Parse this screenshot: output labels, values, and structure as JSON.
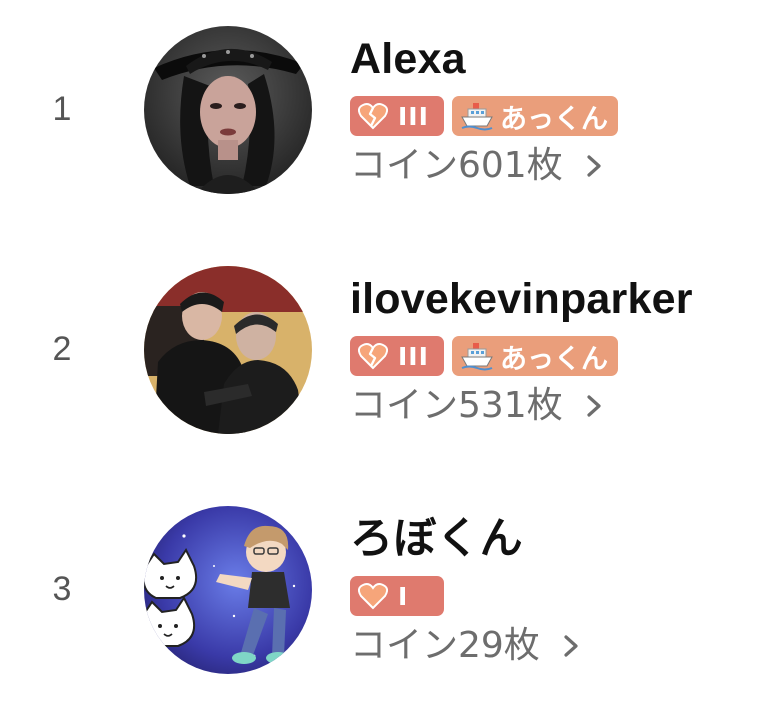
{
  "ranking": [
    {
      "rank": "1",
      "name": "Alexa",
      "level_badge": {
        "icon": "split-heart-icon",
        "level": "III",
        "color": "#df7a6e"
      },
      "ship_badge": {
        "icon": "ship-icon",
        "label": "あっくん",
        "color": "#ea9e7b"
      },
      "coins": "コイン601枚"
    },
    {
      "rank": "2",
      "name": "ilovekevinparker",
      "level_badge": {
        "icon": "split-heart-icon",
        "level": "III",
        "color": "#df7a6e"
      },
      "ship_badge": {
        "icon": "ship-icon",
        "label": "あっくん",
        "color": "#ea9e7b"
      },
      "coins": "コイン531枚"
    },
    {
      "rank": "3",
      "name": "ろぼくん",
      "level_badge": {
        "icon": "heart-icon",
        "level": "I",
        "color": "#df7a6e"
      },
      "coins": "コイン29枚"
    }
  ]
}
